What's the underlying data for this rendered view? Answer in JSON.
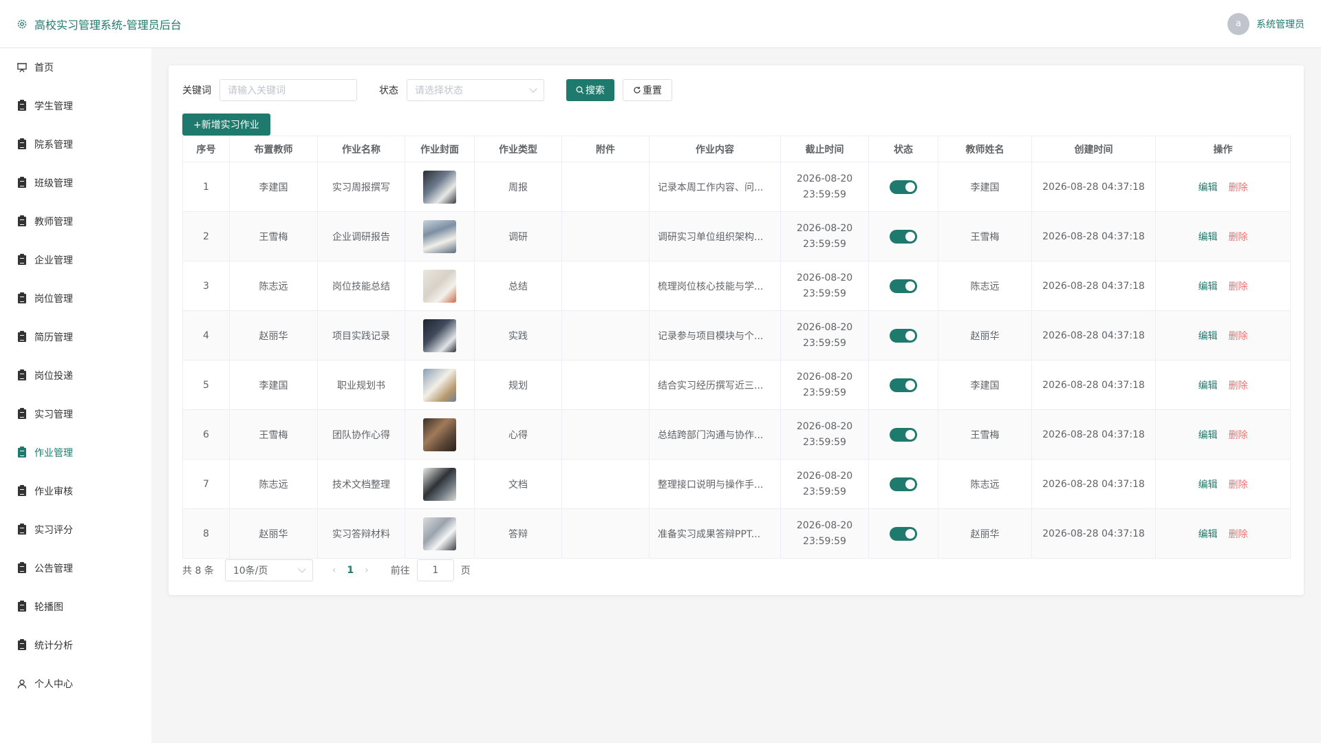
{
  "header": {
    "title": "高校实习管理系统-管理员后台",
    "user_avatar_letter": "a",
    "user_name": "系统管理员"
  },
  "sidebar": {
    "items": [
      {
        "label": "首页",
        "icon": "presentation-icon",
        "active": false
      },
      {
        "label": "学生管理",
        "icon": "clipboard-icon",
        "active": false
      },
      {
        "label": "院系管理",
        "icon": "clipboard-icon",
        "active": false
      },
      {
        "label": "班级管理",
        "icon": "clipboard-icon",
        "active": false
      },
      {
        "label": "教师管理",
        "icon": "clipboard-icon",
        "active": false
      },
      {
        "label": "企业管理",
        "icon": "clipboard-icon",
        "active": false
      },
      {
        "label": "岗位管理",
        "icon": "clipboard-icon",
        "active": false
      },
      {
        "label": "简历管理",
        "icon": "clipboard-icon",
        "active": false
      },
      {
        "label": "岗位投递",
        "icon": "clipboard-icon",
        "active": false
      },
      {
        "label": "实习管理",
        "icon": "clipboard-icon",
        "active": false
      },
      {
        "label": "作业管理",
        "icon": "clipboard-icon",
        "active": true
      },
      {
        "label": "作业审核",
        "icon": "clipboard-icon",
        "active": false
      },
      {
        "label": "实习评分",
        "icon": "clipboard-icon",
        "active": false
      },
      {
        "label": "公告管理",
        "icon": "clipboard-icon",
        "active": false
      },
      {
        "label": "轮播图",
        "icon": "clipboard-icon",
        "active": false
      },
      {
        "label": "统计分析",
        "icon": "clipboard-icon",
        "active": false
      },
      {
        "label": "个人中心",
        "icon": "user-icon",
        "active": false
      }
    ]
  },
  "filters": {
    "keyword_label": "关键词",
    "keyword_placeholder": "请输入关键词",
    "status_label": "状态",
    "status_placeholder": "请选择状态",
    "search_label": "搜索",
    "reset_label": "重置"
  },
  "actions": {
    "add_label": "+新增实习作业"
  },
  "table": {
    "columns": [
      "序号",
      "布置教师",
      "作业名称",
      "作业封面",
      "作业类型",
      "附件",
      "作业内容",
      "截止时间",
      "状态",
      "教师姓名",
      "创建时间",
      "操作"
    ],
    "rows": [
      {
        "no": "1",
        "teacher": "李建国",
        "name": "实习周报撰写",
        "type": "周报",
        "attachment": "",
        "content": "记录本周工作内容、问...",
        "deadline_date": "2026-08-20",
        "deadline_time": "23:59:59",
        "status_on": true,
        "teacher_name": "李建国",
        "created": "2026-08-28 04:37:18",
        "edit": "编辑",
        "delete": "删除"
      },
      {
        "no": "2",
        "teacher": "王雪梅",
        "name": "企业调研报告",
        "type": "调研",
        "attachment": "",
        "content": "调研实习单位组织架构...",
        "deadline_date": "2026-08-20",
        "deadline_time": "23:59:59",
        "status_on": true,
        "teacher_name": "王雪梅",
        "created": "2026-08-28 04:37:18",
        "edit": "编辑",
        "delete": "删除"
      },
      {
        "no": "3",
        "teacher": "陈志远",
        "name": "岗位技能总结",
        "type": "总结",
        "attachment": "",
        "content": "梳理岗位核心技能与学...",
        "deadline_date": "2026-08-20",
        "deadline_time": "23:59:59",
        "status_on": true,
        "teacher_name": "陈志远",
        "created": "2026-08-28 04:37:18",
        "edit": "编辑",
        "delete": "删除"
      },
      {
        "no": "4",
        "teacher": "赵丽华",
        "name": "项目实践记录",
        "type": "实践",
        "attachment": "",
        "content": "记录参与项目模块与个...",
        "deadline_date": "2026-08-20",
        "deadline_time": "23:59:59",
        "status_on": true,
        "teacher_name": "赵丽华",
        "created": "2026-08-28 04:37:18",
        "edit": "编辑",
        "delete": "删除"
      },
      {
        "no": "5",
        "teacher": "李建国",
        "name": "职业规划书",
        "type": "规划",
        "attachment": "",
        "content": "结合实习经历撰写近三...",
        "deadline_date": "2026-08-20",
        "deadline_time": "23:59:59",
        "status_on": true,
        "teacher_name": "李建国",
        "created": "2026-08-28 04:37:18",
        "edit": "编辑",
        "delete": "删除"
      },
      {
        "no": "6",
        "teacher": "王雪梅",
        "name": "团队协作心得",
        "type": "心得",
        "attachment": "",
        "content": "总结跨部门沟通与协作...",
        "deadline_date": "2026-08-20",
        "deadline_time": "23:59:59",
        "status_on": true,
        "teacher_name": "王雪梅",
        "created": "2026-08-28 04:37:18",
        "edit": "编辑",
        "delete": "删除"
      },
      {
        "no": "7",
        "teacher": "陈志远",
        "name": "技术文档整理",
        "type": "文档",
        "attachment": "",
        "content": "整理接口说明与操作手...",
        "deadline_date": "2026-08-20",
        "deadline_time": "23:59:59",
        "status_on": true,
        "teacher_name": "陈志远",
        "created": "2026-08-28 04:37:18",
        "edit": "编辑",
        "delete": "删除"
      },
      {
        "no": "8",
        "teacher": "赵丽华",
        "name": "实习答辩材料",
        "type": "答辩",
        "attachment": "",
        "content": "准备实习成果答辩PPT...",
        "deadline_date": "2026-08-20",
        "deadline_time": "23:59:59",
        "status_on": true,
        "teacher_name": "赵丽华",
        "created": "2026-08-28 04:37:18",
        "edit": "编辑",
        "delete": "删除"
      }
    ]
  },
  "pagination": {
    "total_label": "共 8 条",
    "page_size": "10条/页",
    "current_page": "1",
    "goto_label": "前往",
    "goto_value": "1",
    "page_suffix": "页"
  },
  "colors": {
    "accent": "#1f7a6e",
    "danger": "#f56c6c"
  }
}
